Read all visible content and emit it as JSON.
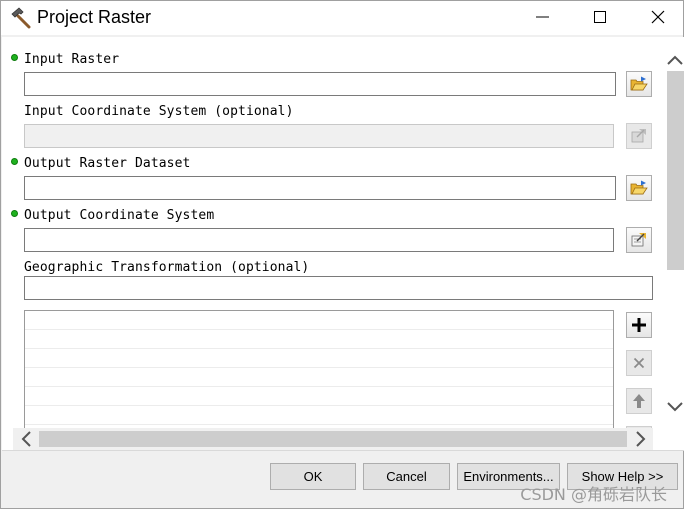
{
  "window": {
    "title": "Project Raster",
    "accent_colors": {
      "required_dot": "#1fb21f",
      "folder": "#e8b431"
    }
  },
  "form": {
    "input_raster": {
      "label": "Input Raster",
      "value": "",
      "required": true,
      "icon": "folder-open-icon"
    },
    "input_coord_system": {
      "label": "Input Coordinate System (optional)",
      "value": "",
      "required": false,
      "disabled": true,
      "icon": "spatial-reference-icon"
    },
    "output_raster": {
      "label": "Output Raster Dataset",
      "value": "",
      "required": true,
      "icon": "folder-open-icon"
    },
    "output_coord_system": {
      "label": "Output Coordinate System",
      "value": "",
      "required": true,
      "icon": "spatial-reference-icon"
    },
    "geo_transform": {
      "label": "Geographic Transformation (optional)",
      "value": ""
    }
  },
  "list_tools": [
    "add-icon",
    "remove-icon",
    "move-up-icon",
    "move-down-icon"
  ],
  "buttons": {
    "ok": "OK",
    "cancel": "Cancel",
    "environments": "Environments...",
    "show_help": "Show Help >>"
  },
  "watermark": "CSDN @角砾岩队长"
}
